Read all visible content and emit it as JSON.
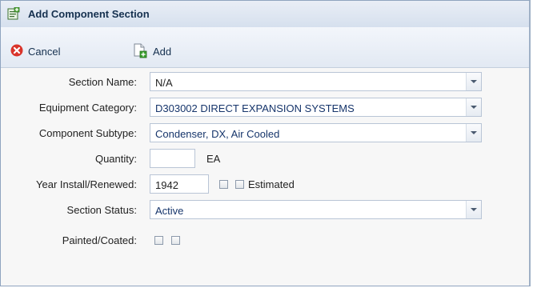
{
  "window": {
    "title": "Add Component Section",
    "title_icon": "form-icon"
  },
  "toolbar": {
    "cancel_label": "Cancel",
    "cancel_icon": "cancel-icon",
    "add_label": "Add",
    "add_icon": "add-document-icon"
  },
  "form": {
    "section_name": {
      "label": "Section Name:",
      "value": "N/A"
    },
    "equipment_category": {
      "label": "Equipment Category:",
      "value": "D303002 DIRECT EXPANSION SYSTEMS"
    },
    "component_subtype": {
      "label": "Component Subtype:",
      "value": "Condenser, DX, Air Cooled"
    },
    "quantity": {
      "label": "Quantity:",
      "value": "",
      "unit": "EA"
    },
    "year_install": {
      "label": "Year Install/Renewed:",
      "value": "1942",
      "estimated_label": "Estimated"
    },
    "section_status": {
      "label": "Section Status:",
      "value": "Active"
    },
    "painted_coated": {
      "label": "Painted/Coated:"
    }
  },
  "colors": {
    "title_text": "#15304f",
    "combo_text": "#16356b",
    "cancel_red": "#d9342b",
    "add_green": "#3aa12f"
  }
}
